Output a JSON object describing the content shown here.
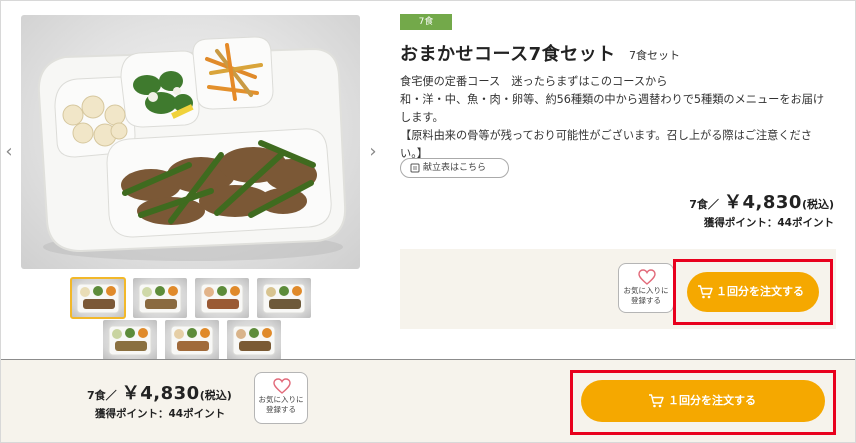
{
  "product": {
    "tag": "7食",
    "title": "おまかせコース7食セット",
    "subtitle": "7食セット",
    "description": [
      "食宅便の定番コース　迷ったらまずはこのコースから",
      "和・洋・中、魚・肉・卵等、約56種類の中から週替わりで5種類のメニューをお届けします。",
      "【原料由来の骨等が残っており可能性がございます。召し上がる際はご注意ください。】"
    ],
    "menu_button": "献立表はこちら"
  },
  "pricing": {
    "quantity": "7食／",
    "price": "￥4,830",
    "tax": "(税込)",
    "points": "獲得ポイント：44ポイント"
  },
  "actions": {
    "favorite_line1": "お気に入りに",
    "favorite_line2": "登録する",
    "order_label": "１回分を注文する"
  },
  "gallery": {
    "thumbnail_count": 7,
    "active_index": 0
  },
  "colors": {
    "accent": "#f5a800",
    "tag_green": "#73a94a",
    "highlight_red": "#e8001d",
    "panel_bg": "#f6f3ec"
  }
}
